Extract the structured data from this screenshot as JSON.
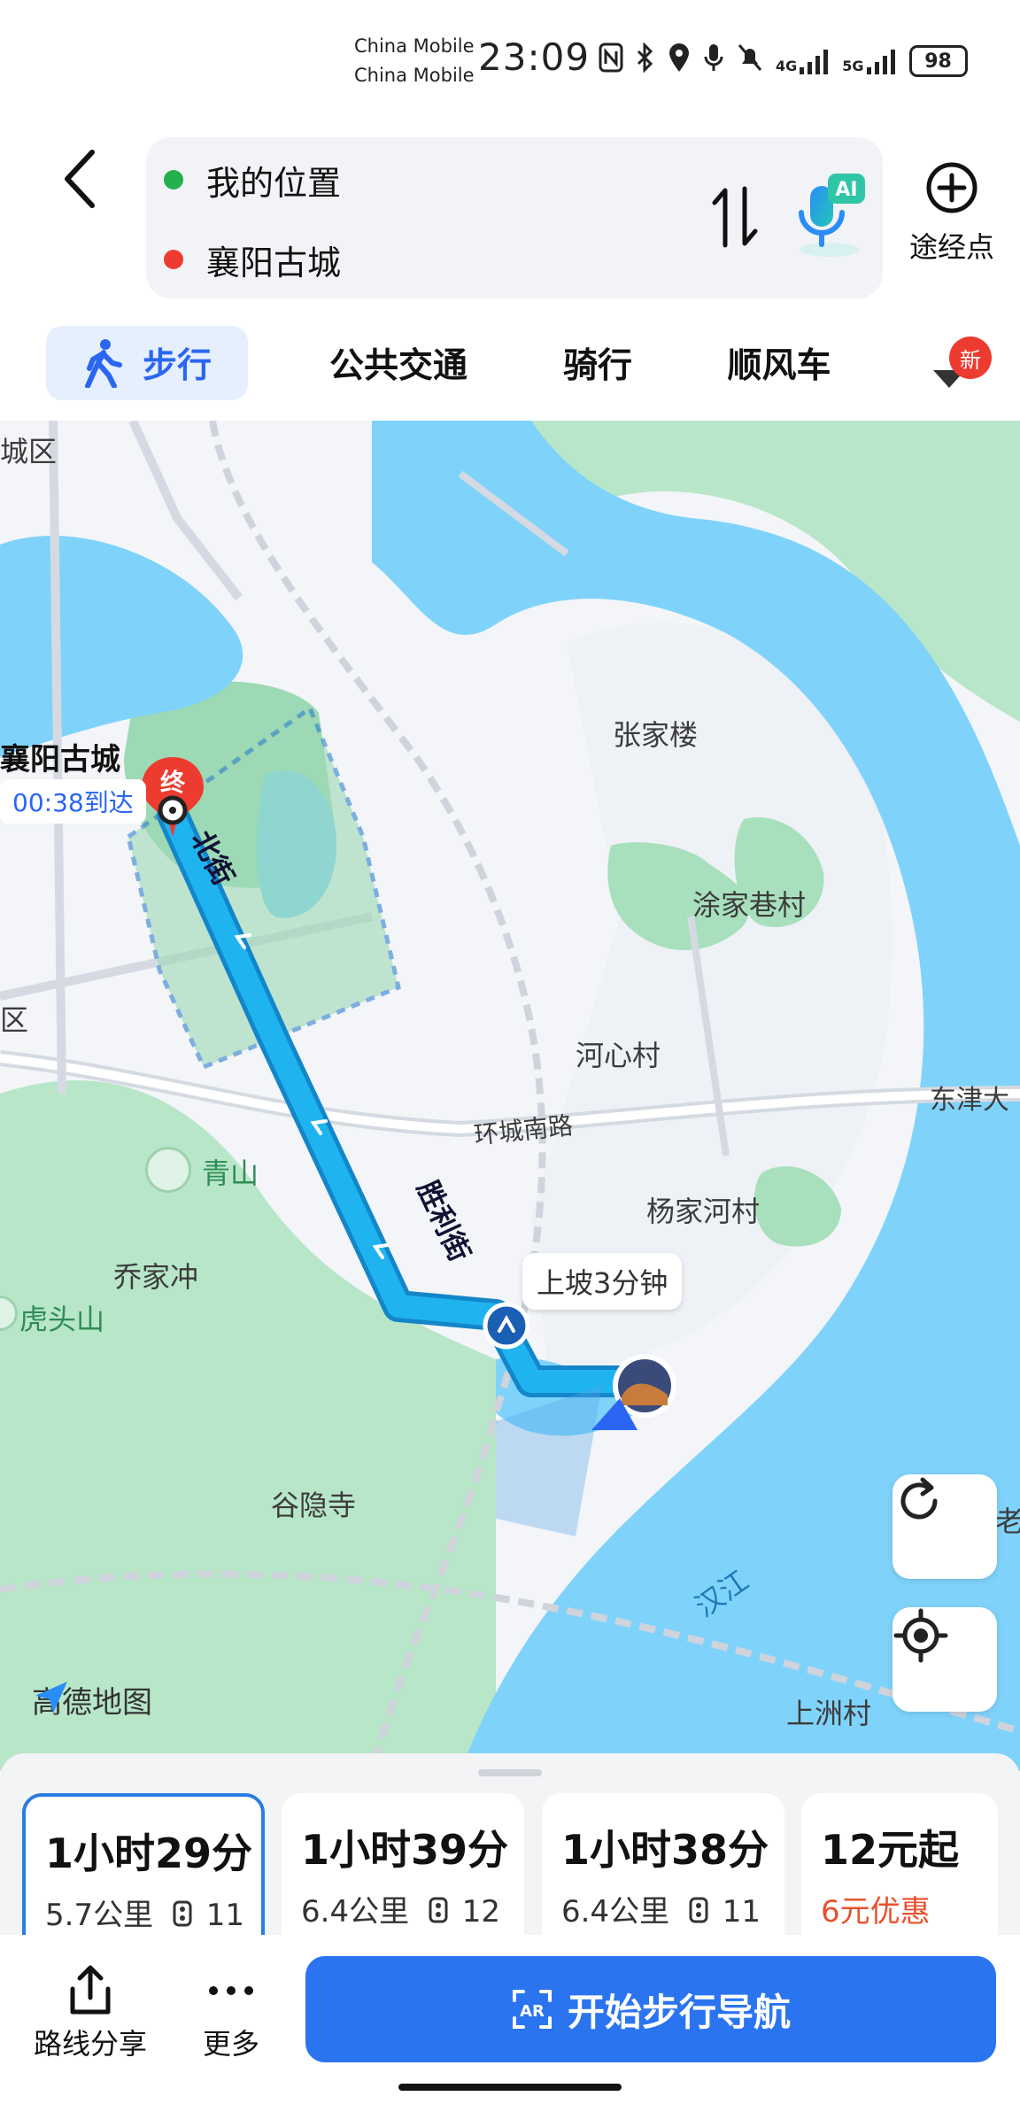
{
  "status_bar": {
    "carrier_1": "China Mobile",
    "carrier_2": "China Mobile",
    "time": "23:09",
    "network": "4G",
    "network_2": "5G",
    "battery": "98"
  },
  "header": {
    "origin": "我的位置",
    "destination": "襄阳古城",
    "ai_badge": "AI",
    "waypoint_label": "途经点",
    "origin_color": "#22b14c",
    "destination_color": "#ee3b30"
  },
  "tabs": {
    "items": [
      {
        "label": "步行",
        "active": true
      },
      {
        "label": "公共交通",
        "active": false
      },
      {
        "label": "骑行",
        "active": false
      },
      {
        "label": "顺风车",
        "active": false
      }
    ],
    "new_badge": "新"
  },
  "map": {
    "labels": {
      "district_top": "城区",
      "district_left": "区",
      "zhangjialou": "张家楼",
      "tujiaxiangcun": "涂家巷村",
      "hexincun": "河心村",
      "dongjin": "东津大",
      "huanchengnanlu": "环城南路",
      "qingshan": "青山",
      "yangjiahecun": "杨家河村",
      "qiaojiachong": "乔家冲",
      "hutoushan": "虎头山",
      "guyinsi": "谷隐寺",
      "hanjiang": "汉江",
      "shangzhoucun": "上洲村",
      "right_edge": "老",
      "beijie": "北街",
      "shenglijie": "胜利街"
    },
    "dest_label": "襄阳古城",
    "dest_marker": "终",
    "eta": "00:38到达",
    "callout": "上坡3分钟",
    "logo": "高德地图",
    "colors": {
      "water": "#7fd3fb",
      "green": "#b8e6c8",
      "route": "#1fb4f0",
      "route_dark": "#1386c9"
    }
  },
  "routes": [
    {
      "duration": "1小时29分",
      "distance": "5.7公里",
      "lights": "11",
      "selected": true
    },
    {
      "duration": "1小时39分",
      "distance": "6.4公里",
      "lights": "12",
      "selected": false
    },
    {
      "duration": "1小时38分",
      "distance": "6.4公里",
      "lights": "11",
      "selected": false
    },
    {
      "duration": "12元起",
      "promo": "6元优惠",
      "selected": false
    }
  ],
  "bottom": {
    "share_label": "路线分享",
    "more_label": "更多",
    "ar_icon": "AR",
    "nav_label": "开始步行导航"
  }
}
